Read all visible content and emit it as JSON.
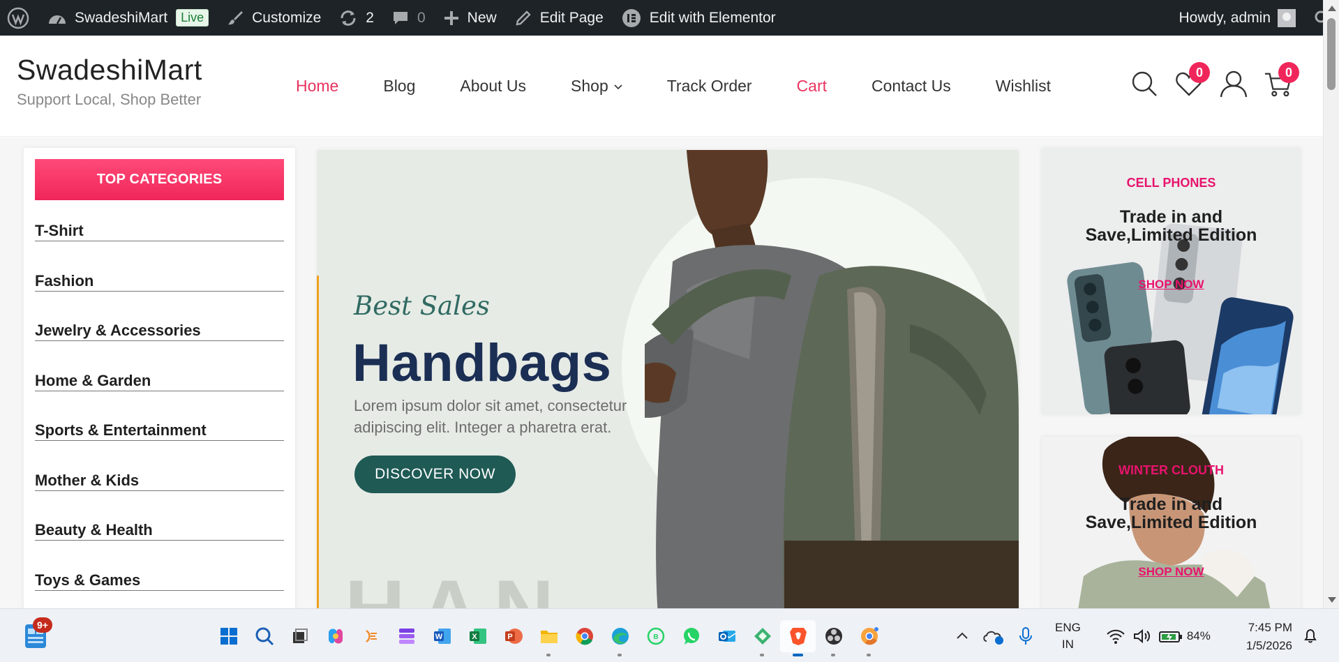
{
  "adminbar": {
    "site_name": "SwadeshiMart",
    "live_badge": "Live",
    "customize": "Customize",
    "updates_count": "2",
    "comments_count": "0",
    "new": "New",
    "edit_page": "Edit Page",
    "edit_elementor": "Edit with Elementor",
    "howdy": "Howdy, admin",
    "icons": [
      "wordpress-icon",
      "dashboard-icon",
      "brush-icon",
      "refresh-icon",
      "comment-icon",
      "plus-icon",
      "pencil-icon",
      "elementor-icon",
      "avatar",
      "search-icon"
    ]
  },
  "header": {
    "title": "SwadeshiMart",
    "tagline": "Support Local, Shop Better",
    "nav": [
      {
        "label": "Home",
        "active": true
      },
      {
        "label": "Blog"
      },
      {
        "label": "About Us"
      },
      {
        "label": "Shop",
        "dropdown": true
      },
      {
        "label": "Track Order"
      },
      {
        "label": "Cart",
        "active": true
      },
      {
        "label": "Contact Us"
      },
      {
        "label": "Wishlist"
      }
    ],
    "wishlist_count": "0",
    "cart_count": "0",
    "accent_color": "#f0265a"
  },
  "categories": {
    "heading": "TOP CATEGORIES",
    "items": [
      "T-Shirt",
      "Fashion",
      "Jewelry & Accessories",
      "Home & Garden",
      "Sports & Entertainment",
      "Mother & Kids",
      "Beauty & Health",
      "Toys & Games"
    ]
  },
  "hero": {
    "kicker": "Best Sales",
    "title": "Handbags",
    "text": "Lorem ipsum dolor sit amet, consectetur adipiscing elit. Integer a pharetra erat.",
    "button": "DISCOVER NOW",
    "watermark": "HAN"
  },
  "promos": [
    {
      "kicker": "CELL PHONES",
      "title_line1": "Trade in and",
      "title_line2": "Save,Limited Edition",
      "link": "SHOP NOW"
    },
    {
      "kicker": "WINTER CLOUTH",
      "title_line1": "Trade in and",
      "title_line2": "Save,Limited Edition",
      "link": "SHOP NOW"
    }
  ],
  "taskbar": {
    "widget_badge": "9+",
    "apps": [
      "windows-start-icon",
      "search-icon",
      "task-view-icon",
      "copilot-icon",
      "app-icon",
      "stack-icon",
      "word-icon",
      "excel-icon",
      "powerpoint-icon",
      "file-explorer-icon",
      "chrome-icon",
      "edge-icon",
      "whatsapp-business-icon",
      "whatsapp-icon",
      "outlook-icon",
      "app-icon",
      "brave-icon",
      "obs-icon",
      "chrome-canary-icon"
    ],
    "lang_top": "ENG",
    "lang_bottom": "IN",
    "battery": "84%",
    "time": "7:45 PM",
    "date": "1/5/2026"
  }
}
